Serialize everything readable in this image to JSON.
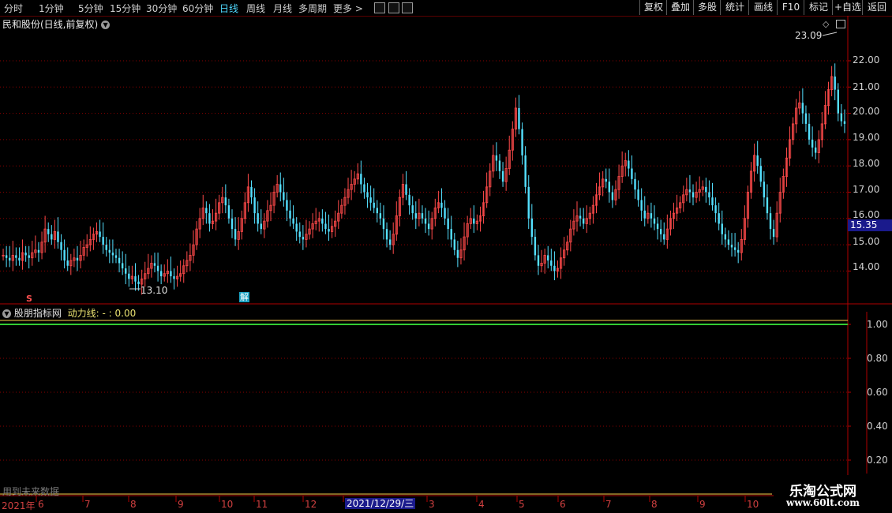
{
  "toolbar": {
    "period_tabs": [
      "分时",
      "1分钟",
      "5分钟",
      "15分钟",
      "30分钟",
      "60分钟",
      "日线",
      "周线",
      "月线",
      "多周期",
      "更多 >"
    ],
    "active_tab": "日线",
    "right_buttons": [
      "复权",
      "叠加",
      "多股",
      "统计",
      "画线",
      "F10",
      "标记",
      "+自选",
      "返回"
    ]
  },
  "chart_header": {
    "title": "民和股份(日线,前复权)",
    "indicator_name": "股朋指标网",
    "indicator_line": "动力线: - : 0.00",
    "future_data_note": "用到未来数据"
  },
  "price_panel": {
    "y_ticks": [
      "22.00",
      "21.00",
      "20.00",
      "19.00",
      "18.00",
      "17.00",
      "16.00",
      "15.00",
      "14.00"
    ],
    "current_price": "15.35",
    "max_marker": "23.09",
    "min_marker": "13.10",
    "event_marker": "解",
    "s_marker": "S"
  },
  "indicator_panel": {
    "y_ticks": [
      "1.00",
      "0.80",
      "0.60",
      "0.40",
      "0.20"
    ]
  },
  "x_axis": {
    "labels": [
      "2021年",
      "6",
      "7",
      "8",
      "9",
      "10",
      "11",
      "12",
      "3",
      "4",
      "5",
      "6",
      "7",
      "8",
      "9",
      "10"
    ],
    "selected_date": "2021/12/29/三"
  },
  "watermark": {
    "title": "乐淘公式网",
    "url": "www.60lt.com"
  },
  "colors": {
    "up": "#ff4a4a",
    "down": "#54e0ff",
    "grid": "#8b0000",
    "line_green": "#33cc33",
    "line_yellow": "#ffd24a"
  },
  "chart_data": {
    "type": "candlestick",
    "ylim": [
      13.3,
      23.6
    ],
    "closes": [
      14.6,
      14.5,
      14.4,
      14.6,
      14.5,
      14.4,
      14.7,
      14.6,
      14.5,
      14.7,
      14.8,
      14.7,
      15.1,
      15.6,
      15.4,
      15.2,
      15.5,
      15.1,
      14.8,
      14.4,
      14.2,
      14.4,
      14.5,
      14.4,
      14.6,
      14.9,
      15.0,
      15.2,
      15.4,
      15.5,
      15.3,
      15.0,
      14.8,
      14.7,
      14.6,
      14.5,
      14.3,
      14.1,
      13.9,
      13.7,
      13.8,
      13.6,
      13.5,
      13.7,
      13.9,
      14.1,
      14.3,
      14.2,
      14.0,
      13.8,
      13.9,
      14.0,
      13.8,
      13.7,
      13.8,
      13.9,
      14.2,
      14.4,
      14.6,
      15.0,
      15.6,
      16.0,
      16.4,
      16.2,
      15.8,
      15.9,
      16.2,
      16.6,
      16.8,
      16.5,
      16.0,
      15.6,
      15.2,
      15.5,
      16.0,
      16.6,
      17.2,
      16.8,
      16.2,
      15.8,
      15.6,
      15.9,
      16.3,
      16.5,
      17.0,
      17.3,
      17.0,
      16.7,
      16.3,
      16.0,
      15.8,
      15.5,
      15.3,
      15.2,
      15.4,
      15.6,
      15.8,
      15.9,
      16.0,
      15.8,
      15.6,
      15.5,
      15.7,
      15.9,
      16.2,
      16.5,
      16.8,
      17.1,
      17.3,
      17.5,
      17.7,
      17.3,
      17.0,
      16.8,
      16.6,
      16.4,
      16.2,
      16.0,
      15.6,
      15.2,
      15.0,
      15.4,
      16.1,
      16.8,
      17.3,
      16.9,
      16.5,
      16.2,
      16.0,
      16.2,
      16.0,
      15.8,
      15.6,
      16.0,
      16.4,
      16.6,
      16.4,
      16.0,
      15.6,
      15.2,
      14.8,
      14.5,
      14.8,
      15.3,
      15.8,
      16.0,
      15.8,
      15.9,
      16.1,
      16.6,
      17.2,
      17.8,
      18.4,
      18.2,
      17.8,
      17.4,
      17.9,
      18.6,
      19.4,
      20.2,
      19.4,
      18.4,
      17.2,
      16.0,
      15.3,
      14.6,
      14.2,
      14.3,
      14.6,
      14.4,
      14.2,
      14.0,
      14.1,
      14.5,
      14.8,
      15.1,
      15.6,
      15.9,
      16.1,
      16.0,
      15.8,
      16.0,
      16.2,
      16.5,
      16.9,
      17.2,
      17.5,
      17.4,
      17.0,
      16.7,
      17.1,
      17.6,
      18.0,
      18.2,
      17.9,
      17.5,
      17.1,
      16.7,
      16.3,
      16.0,
      16.2,
      16.0,
      15.8,
      15.6,
      15.4,
      15.2,
      15.6,
      16.0,
      16.2,
      16.4,
      16.6,
      16.9,
      17.1,
      17.0,
      16.8,
      17.0,
      17.1,
      17.2,
      17.0,
      16.8,
      16.5,
      16.2,
      15.8,
      15.4,
      15.2,
      15.0,
      14.9,
      14.8,
      14.7,
      15.2,
      16.0,
      17.0,
      17.8,
      18.4,
      18.0,
      17.4,
      16.8,
      16.2,
      15.6,
      15.3,
      16.2,
      17.0,
      17.6,
      18.3,
      19.0,
      19.6,
      20.2,
      20.4,
      20.0,
      19.6,
      19.0,
      18.7,
      18.5,
      19.0,
      19.6,
      20.3,
      20.9,
      21.4,
      20.9,
      20.0,
      19.7,
      19.6
    ]
  }
}
